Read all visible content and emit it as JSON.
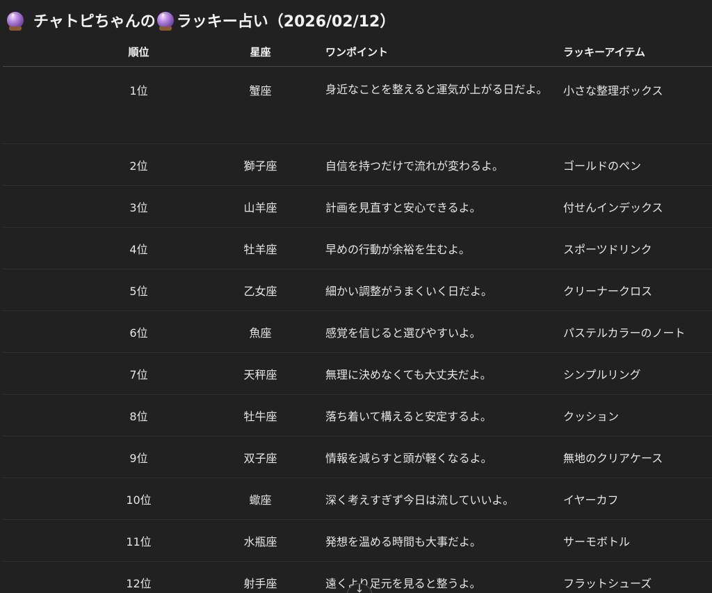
{
  "title": {
    "text_1": "チャトピちゃんの",
    "text_2": "ラッキー占い（2026/02/12）"
  },
  "table": {
    "headers": {
      "rank": "順位",
      "sign": "星座",
      "point": "ワンポイント",
      "item": "ラッキーアイテム"
    },
    "rows": [
      {
        "rank": "1位",
        "sign": "蟹座",
        "point": "身近なことを整えると運気が上がる日だよ。",
        "item": "小さな整理ボックス"
      },
      {
        "rank": "2位",
        "sign": "獅子座",
        "point": "自信を持つだけで流れが変わるよ。",
        "item": "ゴールドのペン"
      },
      {
        "rank": "3位",
        "sign": "山羊座",
        "point": "計画を見直すと安心できるよ。",
        "item": "付せんインデックス"
      },
      {
        "rank": "4位",
        "sign": "牡羊座",
        "point": "早めの行動が余裕を生むよ。",
        "item": "スポーツドリンク"
      },
      {
        "rank": "5位",
        "sign": "乙女座",
        "point": "細かい調整がうまくいく日だよ。",
        "item": "クリーナークロス"
      },
      {
        "rank": "6位",
        "sign": "魚座",
        "point": "感覚を信じると選びやすいよ。",
        "item": "パステルカラーのノート"
      },
      {
        "rank": "7位",
        "sign": "天秤座",
        "point": "無理に決めなくても大丈夫だよ。",
        "item": "シンプルリング"
      },
      {
        "rank": "8位",
        "sign": "牡牛座",
        "point": "落ち着いて構えると安定するよ。",
        "item": "クッション"
      },
      {
        "rank": "9位",
        "sign": "双子座",
        "point": "情報を減らすと頭が軽くなるよ。",
        "item": "無地のクリアケース"
      },
      {
        "rank": "10位",
        "sign": "蠍座",
        "point": "深く考えすぎず今日は流していいよ。",
        "item": "イヤーカフ"
      },
      {
        "rank": "11位",
        "sign": "水瓶座",
        "point": "発想を温める時間も大事だよ。",
        "item": "サーモボトル"
      },
      {
        "rank": "12位",
        "sign": "射手座",
        "point": "遠くより足元を見ると整うよ。",
        "item": "フラットシューズ"
      }
    ]
  },
  "icons": {
    "title_icon": "crystal-ball-icon",
    "scroll": "arrow-down-icon"
  },
  "colors": {
    "background": "#212121",
    "text": "#ececec",
    "divider": "#2f2f2f"
  }
}
